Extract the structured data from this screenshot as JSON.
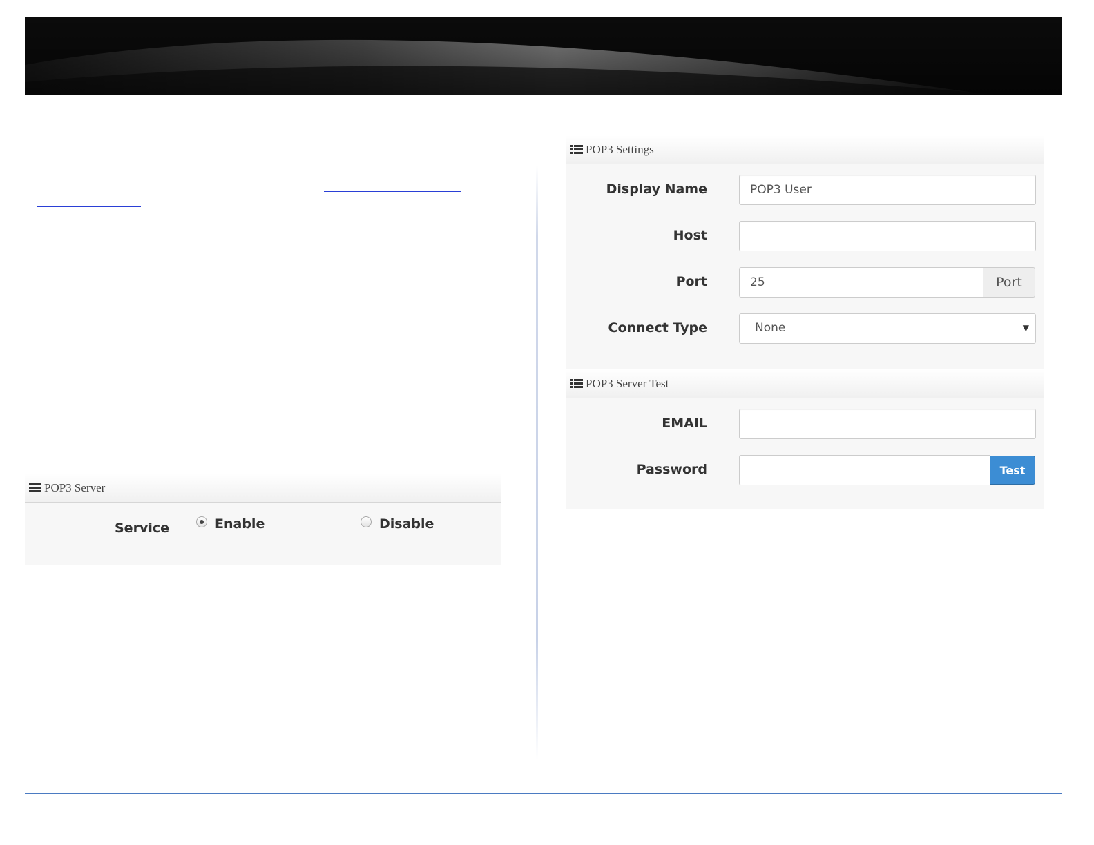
{
  "pop3_server": {
    "title": "POP3 Server",
    "service_label": "Service",
    "options": [
      "Enable",
      "Disable"
    ],
    "selected": "Enable"
  },
  "pop3_settings": {
    "title": "POP3 Settings",
    "display_name_label": "Display Name",
    "display_name_value": "POP3 User",
    "host_label": "Host",
    "host_value": "",
    "port_label": "Port",
    "port_value": "25",
    "port_addon": "Port",
    "connect_type_label": "Connect Type",
    "connect_type_value": "None"
  },
  "pop3_server_test": {
    "title": "POP3 Server Test",
    "email_label": "EMAIL",
    "email_value": "",
    "password_label": "Password",
    "password_value": "",
    "test_button": "Test"
  },
  "colors": {
    "link": "#2a3fd6",
    "footer_rule": "#4b7bc2",
    "test_button": "#3c8dd4"
  }
}
